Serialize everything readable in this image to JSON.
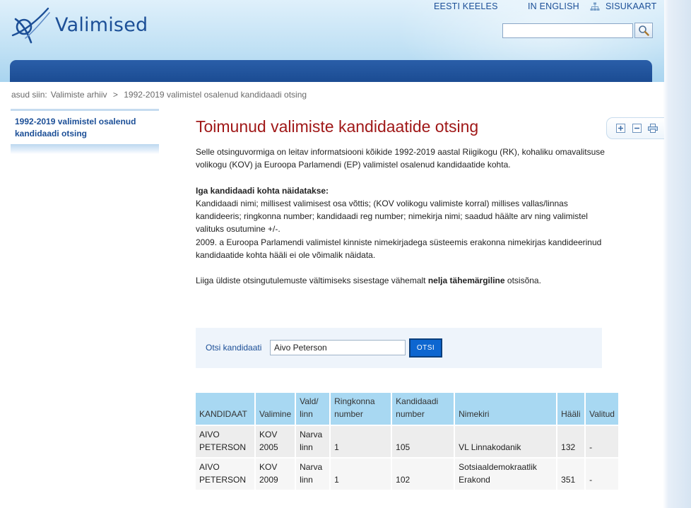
{
  "header": {
    "logo_text": "Valimised",
    "links": [
      "EESTI KEELES",
      "IN ENGLISH",
      "SISUKAART"
    ],
    "search_placeholder": ""
  },
  "breadcrumb": {
    "prefix": "asud siin:",
    "items": [
      "Valimiste arhiiv",
      ">",
      "1992-2019 valimistel osalenud kandidaadi otsing"
    ]
  },
  "sidebar": {
    "items": [
      {
        "label": "1992-2019 valimistel osalenud kandidaadi otsing"
      }
    ]
  },
  "main": {
    "title": "Toimunud valimiste kandidaatide otsing",
    "intro": "Selle otsinguvormiga on leitav informatsiooni kõikide 1992-2019 aastal Riigikogu (RK), kohaliku omavalitsuse volikogu (KOV) ja Euroopa Parlamendi (EP) valimistel osalenud kandidaatide kohta.",
    "shown_heading": "Iga kandidaadi kohta näidatakse:",
    "shown_text": "Kandidaadi nimi; millisest valimisest osa võttis; (KOV volikogu valimiste korral) millises vallas/linnas kandideeris; ringkonna number; kandidaadi reg number; nimekirja nimi; saadud häälte arv ning valimistel valituks osutumine +/-.",
    "ep_note": "2009. a Euroopa Parlamendi valimistel kinniste nimekirjadega süsteemis erakonna nimekirjas kandideerinud kandidaatide kohta hääli ei ole võimalik näidata.",
    "hint_before": "Liiga üldiste otsingutulemuste vältimiseks sisestage vähemalt",
    "hint_bold": "nelja tähemärgiline",
    "hint_after": "otsisõna."
  },
  "search_form": {
    "label": "Otsi kandidaati",
    "value": "Aivo Peterson",
    "button": "OTSI"
  },
  "table": {
    "headers": [
      "KANDIDAAT",
      "Valimine",
      "Vald/ linn",
      "Ringkonna number",
      "Kandidaadi number",
      "Nimekiri",
      "Hääli",
      "Valitud"
    ],
    "rows": [
      [
        "AIVO PETERSON",
        "KOV 2005",
        "Narva linn",
        "1",
        "105",
        "VL Linnakodanik",
        "132",
        "-"
      ],
      [
        "AIVO PETERSON",
        "KOV 2009",
        "Narva linn",
        "1",
        "102",
        "Sotsiaaldemokraatlik Erakond",
        "351",
        "-"
      ]
    ]
  },
  "colors": {
    "brand_blue": "#1c4f97",
    "title_red": "#a01818",
    "table_header": "#a8d8f2",
    "button_blue": "#0d66d0"
  }
}
